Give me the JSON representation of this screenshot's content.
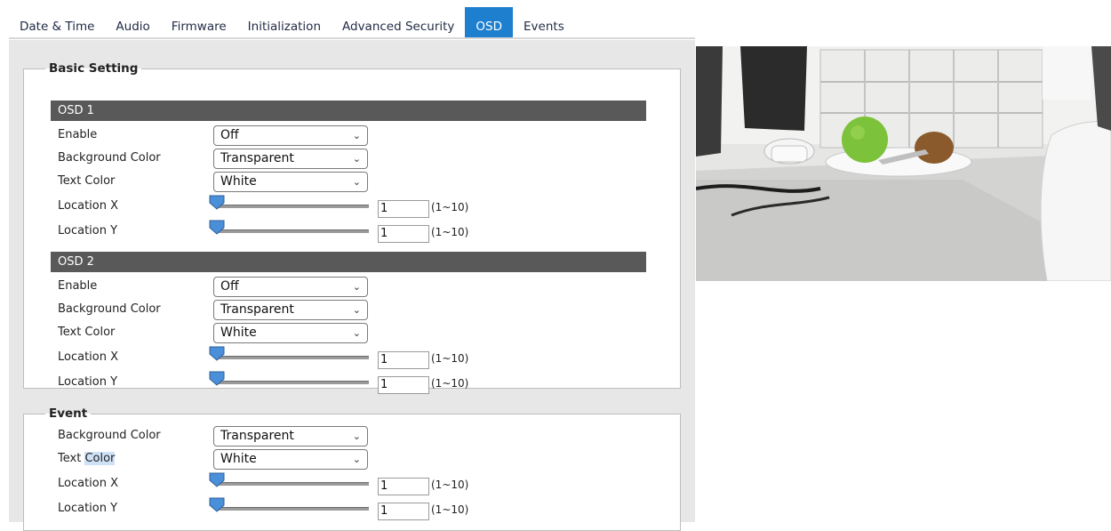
{
  "tabs": [
    "Date & Time",
    "Audio",
    "Firmware",
    "Initialization",
    "Advanced Security",
    "OSD",
    "Events"
  ],
  "active_tab": "OSD",
  "basic": {
    "legend": "Basic Setting",
    "osd1": {
      "title": "OSD 1",
      "enable_label": "Enable",
      "enable_value": "Off",
      "bg_label": "Background Color",
      "bg_value": "Transparent",
      "text_label": "Text Color",
      "text_value": "White",
      "locx_label": "Location X",
      "locx_value": "1",
      "locx_range": "(1~10)",
      "locy_label": "Location Y",
      "locy_value": "1",
      "locy_range": "(1~10)"
    },
    "osd2": {
      "title": "OSD 2",
      "enable_label": "Enable",
      "enable_value": "Off",
      "bg_label": "Background Color",
      "bg_value": "Transparent",
      "text_label": "Text Color",
      "text_value": "White",
      "locx_label": "Location X",
      "locx_value": "1",
      "locx_range": "(1~10)",
      "locy_label": "Location Y",
      "locy_value": "1",
      "locy_range": "(1~10)"
    }
  },
  "event": {
    "legend": "Event",
    "bg_label": "Background Color",
    "bg_value": "Transparent",
    "text_label_a": "Text ",
    "text_label_b": "Color",
    "text_value": "White",
    "locx_label": "Location X",
    "locx_value": "1",
    "locx_range": "(1~10)",
    "locy_label": "Location Y",
    "locy_value": "1",
    "locy_range": "(1~10)"
  },
  "colors": {
    "active_tab": "#1e7fcf",
    "osd_bar": "#595959",
    "panel_bg": "#e7e7e7",
    "slider_thumb": "#4a8fd9"
  },
  "icons": {
    "select_chevron": "chevron-down-icon",
    "slider_thumb": "slider-thumb-icon"
  }
}
